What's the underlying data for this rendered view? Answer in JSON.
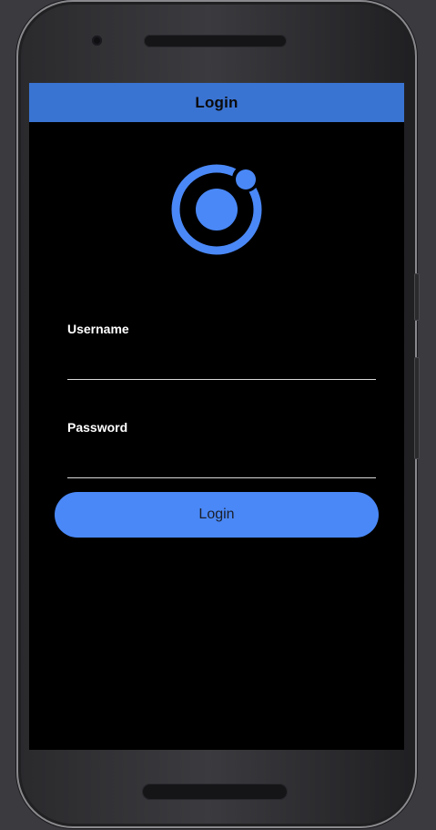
{
  "header": {
    "title": "Login"
  },
  "logo": {
    "icon": "ionic-logo-icon",
    "color": "#4a88f7"
  },
  "form": {
    "username": {
      "label": "Username",
      "value": "",
      "placeholder": ""
    },
    "password": {
      "label": "Password",
      "value": "",
      "placeholder": ""
    },
    "submit_label": "Login"
  },
  "colors": {
    "toolbar": "#3a74d3",
    "button": "#4a88f7",
    "background": "#000000",
    "underline": "#d9d9d9"
  }
}
